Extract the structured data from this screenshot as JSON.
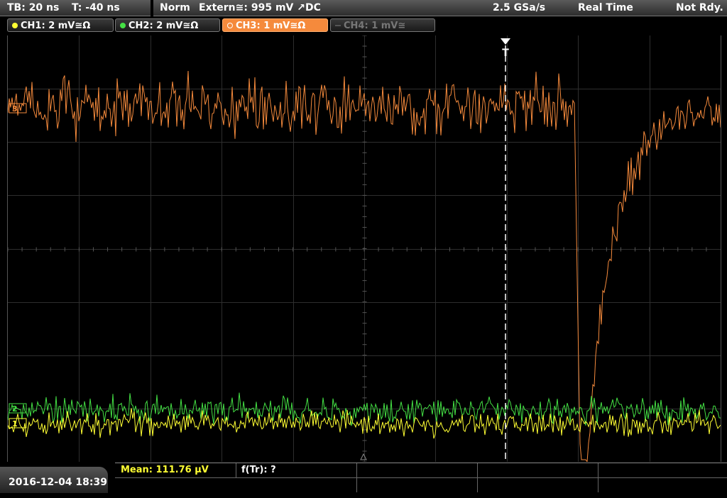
{
  "timebase": {
    "tb": "TB: 20 ns",
    "t": "T: -40 ns"
  },
  "acquisition": {
    "mode": "Norm",
    "trigger": "Extern≅: 995 mV ↗DC",
    "sample_rate": "2.5 GSa/s",
    "realtime": "Real Time",
    "status": "Not Rdy."
  },
  "channels": [
    {
      "label": "CH1: 2 mV≅Ω",
      "color": "#ffff33",
      "state": "on"
    },
    {
      "label": "CH2: 2 mV≅Ω",
      "color": "#44e044",
      "state": "on"
    },
    {
      "label": "CH3: 1 mV≅Ω",
      "color": "#f58a3c",
      "state": "active"
    },
    {
      "label": "CH4: 1 mV≅",
      "color": "#777777",
      "state": "off"
    }
  ],
  "markers": {
    "trigger": "T",
    "ch3": "3",
    "ch2": "2",
    "ch1": "1"
  },
  "measurements": {
    "mean": "Mean: 111.76 µV",
    "ftr": "f(Tr): ?"
  },
  "datetime": "2016-12-04 18:39"
}
